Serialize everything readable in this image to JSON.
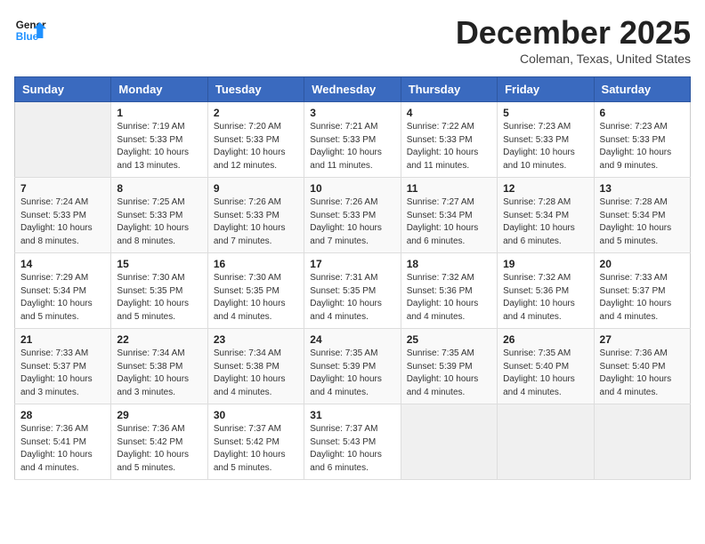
{
  "header": {
    "logo_line1": "General",
    "logo_line2": "Blue",
    "month": "December 2025",
    "location": "Coleman, Texas, United States"
  },
  "weekdays": [
    "Sunday",
    "Monday",
    "Tuesday",
    "Wednesday",
    "Thursday",
    "Friday",
    "Saturday"
  ],
  "weeks": [
    [
      {
        "day": "",
        "info": ""
      },
      {
        "day": "1",
        "info": "Sunrise: 7:19 AM\nSunset: 5:33 PM\nDaylight: 10 hours\nand 13 minutes."
      },
      {
        "day": "2",
        "info": "Sunrise: 7:20 AM\nSunset: 5:33 PM\nDaylight: 10 hours\nand 12 minutes."
      },
      {
        "day": "3",
        "info": "Sunrise: 7:21 AM\nSunset: 5:33 PM\nDaylight: 10 hours\nand 11 minutes."
      },
      {
        "day": "4",
        "info": "Sunrise: 7:22 AM\nSunset: 5:33 PM\nDaylight: 10 hours\nand 11 minutes."
      },
      {
        "day": "5",
        "info": "Sunrise: 7:23 AM\nSunset: 5:33 PM\nDaylight: 10 hours\nand 10 minutes."
      },
      {
        "day": "6",
        "info": "Sunrise: 7:23 AM\nSunset: 5:33 PM\nDaylight: 10 hours\nand 9 minutes."
      }
    ],
    [
      {
        "day": "7",
        "info": "Sunrise: 7:24 AM\nSunset: 5:33 PM\nDaylight: 10 hours\nand 8 minutes."
      },
      {
        "day": "8",
        "info": "Sunrise: 7:25 AM\nSunset: 5:33 PM\nDaylight: 10 hours\nand 8 minutes."
      },
      {
        "day": "9",
        "info": "Sunrise: 7:26 AM\nSunset: 5:33 PM\nDaylight: 10 hours\nand 7 minutes."
      },
      {
        "day": "10",
        "info": "Sunrise: 7:26 AM\nSunset: 5:33 PM\nDaylight: 10 hours\nand 7 minutes."
      },
      {
        "day": "11",
        "info": "Sunrise: 7:27 AM\nSunset: 5:34 PM\nDaylight: 10 hours\nand 6 minutes."
      },
      {
        "day": "12",
        "info": "Sunrise: 7:28 AM\nSunset: 5:34 PM\nDaylight: 10 hours\nand 6 minutes."
      },
      {
        "day": "13",
        "info": "Sunrise: 7:28 AM\nSunset: 5:34 PM\nDaylight: 10 hours\nand 5 minutes."
      }
    ],
    [
      {
        "day": "14",
        "info": "Sunrise: 7:29 AM\nSunset: 5:34 PM\nDaylight: 10 hours\nand 5 minutes."
      },
      {
        "day": "15",
        "info": "Sunrise: 7:30 AM\nSunset: 5:35 PM\nDaylight: 10 hours\nand 5 minutes."
      },
      {
        "day": "16",
        "info": "Sunrise: 7:30 AM\nSunset: 5:35 PM\nDaylight: 10 hours\nand 4 minutes."
      },
      {
        "day": "17",
        "info": "Sunrise: 7:31 AM\nSunset: 5:35 PM\nDaylight: 10 hours\nand 4 minutes."
      },
      {
        "day": "18",
        "info": "Sunrise: 7:32 AM\nSunset: 5:36 PM\nDaylight: 10 hours\nand 4 minutes."
      },
      {
        "day": "19",
        "info": "Sunrise: 7:32 AM\nSunset: 5:36 PM\nDaylight: 10 hours\nand 4 minutes."
      },
      {
        "day": "20",
        "info": "Sunrise: 7:33 AM\nSunset: 5:37 PM\nDaylight: 10 hours\nand 4 minutes."
      }
    ],
    [
      {
        "day": "21",
        "info": "Sunrise: 7:33 AM\nSunset: 5:37 PM\nDaylight: 10 hours\nand 3 minutes."
      },
      {
        "day": "22",
        "info": "Sunrise: 7:34 AM\nSunset: 5:38 PM\nDaylight: 10 hours\nand 3 minutes."
      },
      {
        "day": "23",
        "info": "Sunrise: 7:34 AM\nSunset: 5:38 PM\nDaylight: 10 hours\nand 4 minutes."
      },
      {
        "day": "24",
        "info": "Sunrise: 7:35 AM\nSunset: 5:39 PM\nDaylight: 10 hours\nand 4 minutes."
      },
      {
        "day": "25",
        "info": "Sunrise: 7:35 AM\nSunset: 5:39 PM\nDaylight: 10 hours\nand 4 minutes."
      },
      {
        "day": "26",
        "info": "Sunrise: 7:35 AM\nSunset: 5:40 PM\nDaylight: 10 hours\nand 4 minutes."
      },
      {
        "day": "27",
        "info": "Sunrise: 7:36 AM\nSunset: 5:40 PM\nDaylight: 10 hours\nand 4 minutes."
      }
    ],
    [
      {
        "day": "28",
        "info": "Sunrise: 7:36 AM\nSunset: 5:41 PM\nDaylight: 10 hours\nand 4 minutes."
      },
      {
        "day": "29",
        "info": "Sunrise: 7:36 AM\nSunset: 5:42 PM\nDaylight: 10 hours\nand 5 minutes."
      },
      {
        "day": "30",
        "info": "Sunrise: 7:37 AM\nSunset: 5:42 PM\nDaylight: 10 hours\nand 5 minutes."
      },
      {
        "day": "31",
        "info": "Sunrise: 7:37 AM\nSunset: 5:43 PM\nDaylight: 10 hours\nand 6 minutes."
      },
      {
        "day": "",
        "info": ""
      },
      {
        "day": "",
        "info": ""
      },
      {
        "day": "",
        "info": ""
      }
    ]
  ]
}
